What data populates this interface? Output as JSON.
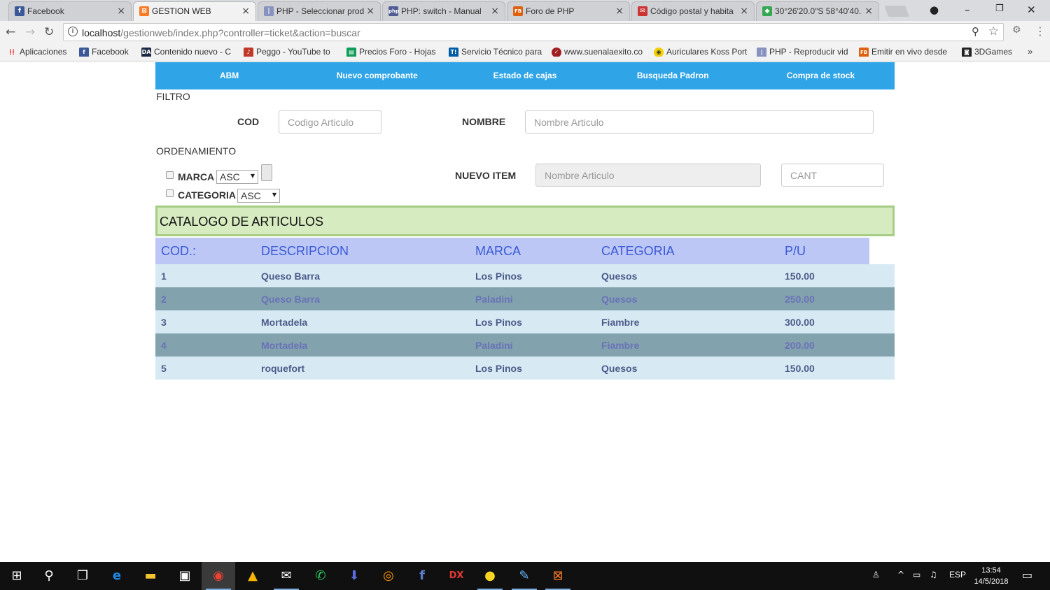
{
  "browser": {
    "tabs": [
      {
        "title": "Facebook",
        "icon": "facebook-icon",
        "color": "#3b5998",
        "glyph": "f"
      },
      {
        "title": "GESTION WEB",
        "icon": "xampp-icon",
        "color": "#fb7a24",
        "glyph": "⊠"
      },
      {
        "title": "PHP - Seleccionar prod",
        "icon": "php-forum-icon",
        "color": "#8892bf",
        "glyph": "|||"
      },
      {
        "title": "PHP: switch - Manual",
        "icon": "php-icon",
        "color": "#4f5b93",
        "glyph": "php"
      },
      {
        "title": "Foro de PHP",
        "icon": "forosdelweb-icon",
        "color": "#e06010",
        "glyph": "FB"
      },
      {
        "title": "Código postal y habita",
        "icon": "correo-icon",
        "color": "#cc3333",
        "glyph": "✉"
      },
      {
        "title": "30°26'20.0\"S 58°40'40.",
        "icon": "google-maps-icon",
        "color": "#34a853",
        "glyph": "◆"
      }
    ],
    "active_tab": 1,
    "close_glyph": "×",
    "url_host": "localhost",
    "url_path": "/gestionweb/index.php?controller=ticket&action=buscar",
    "bookmarks": [
      {
        "label": "Aplicaciones",
        "icon": "apps-icon",
        "color": "#e8453c",
        "glyph": "⁞⁞"
      },
      {
        "label": "Facebook",
        "icon": "facebook-icon",
        "color": "#3b5998",
        "glyph": "f"
      },
      {
        "label": "Contenido nuevo - C",
        "icon": "deviantart-icon",
        "color": "#05cc47",
        "glyph": "DA"
      },
      {
        "label": "Peggo - YouTube to",
        "icon": "peggo-icon",
        "color": "#c0392b",
        "glyph": "♪"
      },
      {
        "label": "Precios Foro - Hojas",
        "icon": "sheets-icon",
        "color": "#0f9d58",
        "glyph": "▤"
      },
      {
        "label": "Servicio Técnico para",
        "icon": "taringa-icon",
        "color": "#005ca5",
        "glyph": "T!"
      },
      {
        "label": "www.suenalaexito.co",
        "icon": "suenalaexito-icon",
        "color": "#a02020",
        "glyph": "✓"
      },
      {
        "label": "Auriculares Koss Port",
        "icon": "mercadolibre-icon",
        "color": "#f0d000",
        "glyph": "◉"
      },
      {
        "label": "PHP - Reproducir vid",
        "icon": "php-forum-icon",
        "color": "#8892bf",
        "glyph": "|||"
      },
      {
        "label": "Emitir en vivo desde",
        "icon": "forosdelweb-icon",
        "color": "#e06010",
        "glyph": "FB"
      },
      {
        "label": "3DGames",
        "icon": "3dgames-icon",
        "color": "#222222",
        "glyph": "◙"
      }
    ],
    "more_bookmarks": "»"
  },
  "page": {
    "menu": [
      "ABM",
      "Nuevo comprobante",
      "Estado de cajas",
      "Busqueda Padron",
      "Compra de stock"
    ],
    "filtro_label": "FILTRO",
    "cod_label": "COD",
    "cod_placeholder": "Codigo Articulo",
    "nombre_label": "NOMBRE",
    "nombre_placeholder": "Nombre Articulo",
    "ordenamiento_label": "ORDENAMIENTO",
    "marca_label": "MARCA",
    "marca_order": "ASC",
    "categoria_label": "CATEGORIA",
    "categoria_order": "ASC",
    "nuevo_item_label": "NUEVO ITEM",
    "nuevo_item_placeholder": "Nombre Articulo",
    "cant_placeholder": "CANT",
    "catalog_title": "CATALOGO DE ARTICULOS",
    "table": {
      "headers": [
        "COD.:",
        "DESCRIPCION",
        "MARCA",
        "CATEGORIA",
        "P/U"
      ],
      "rows": [
        [
          "1",
          "Queso Barra",
          "Los Pinos",
          "Quesos",
          "150.00"
        ],
        [
          "2",
          "Queso Barra",
          "Paladini",
          "Quesos",
          "250.00"
        ],
        [
          "3",
          "Mortadela",
          "Los Pinos",
          "Fiambre",
          "300.00"
        ],
        [
          "4",
          "Mortadela",
          "Paladini",
          "Fiambre",
          "200.00"
        ],
        [
          "5",
          "roquefort",
          "Los Pinos",
          "Quesos",
          "150.00"
        ]
      ]
    },
    "colors": {
      "menu_bg": "#2fa5e7",
      "catalog_bg": "#d7ebc0",
      "header_bg": "#bcc7f6",
      "row_light": "#d7eaf3",
      "row_dark": "#82a2ad"
    }
  },
  "taskbar": {
    "apps": [
      {
        "name": "windows-start-icon",
        "glyph": "⊞",
        "color": "#ffffff"
      },
      {
        "name": "search-icon",
        "glyph": "⚲",
        "color": "#ffffff"
      },
      {
        "name": "task-view-icon",
        "glyph": "❐",
        "color": "#ffffff"
      },
      {
        "name": "edge-icon",
        "glyph": "e",
        "color": "#1e88e5"
      },
      {
        "name": "file-explorer-icon",
        "glyph": "▬",
        "color": "#f4c430"
      },
      {
        "name": "store-icon",
        "glyph": "▣",
        "color": "#ffffff"
      },
      {
        "name": "chrome-icon",
        "glyph": "◉",
        "color": "#ea4335"
      },
      {
        "name": "warning-app-icon",
        "glyph": "▲",
        "color": "#f4b400"
      },
      {
        "name": "mail-icon",
        "glyph": "✉",
        "color": "#ffffff"
      },
      {
        "name": "whatsapp-icon",
        "glyph": "✆",
        "color": "#25d366"
      },
      {
        "name": "downloader-icon",
        "glyph": "⬇",
        "color": "#5b6ee1"
      },
      {
        "name": "orange-app-icon",
        "glyph": "◎",
        "color": "#ff9800"
      },
      {
        "name": "facebook-app-icon",
        "glyph": "f",
        "color": "#3b5998"
      },
      {
        "name": "dx-app-icon",
        "glyph": "DX",
        "color": "#e53935"
      },
      {
        "name": "fruit-app-icon",
        "glyph": "●",
        "color": "#f9d423"
      },
      {
        "name": "notepad-icon",
        "glyph": "✎",
        "color": "#64b5f6"
      },
      {
        "name": "xampp-icon",
        "glyph": "⊠",
        "color": "#fb7a24"
      }
    ],
    "language": "ESP",
    "time": "13:54",
    "date": "14/5/2018"
  }
}
